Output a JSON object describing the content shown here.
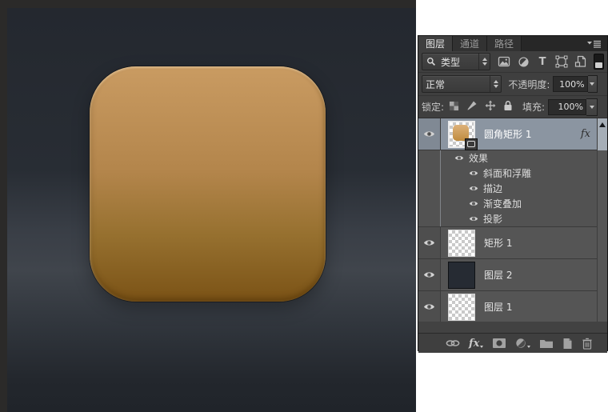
{
  "canvas": {
    "document_bg_top": "#24282f",
    "document_bg_mid": "#40454c",
    "document_bg_bottom": "#20242a",
    "shape": {
      "label": "rounded-rectangle",
      "gradient_top": "#c99b62",
      "gradient_bottom": "#7b5316",
      "radius_px": 58
    }
  },
  "panel": {
    "tabs": [
      {
        "label": "图层",
        "active": true
      },
      {
        "label": "通道",
        "active": false
      },
      {
        "label": "路径",
        "active": false
      }
    ],
    "filter_row": {
      "search_label": "类型",
      "type_letter": "T"
    },
    "blend_row": {
      "blend_mode": "正常",
      "opacity_label": "不透明度:",
      "opacity_value": "100%"
    },
    "lock_row": {
      "lock_label": "锁定:",
      "fill_label": "填充:",
      "fill_value": "100%"
    },
    "layers": [
      {
        "name": "圆角矩形 1",
        "selected": true,
        "fx_badge": "fx",
        "thumb": "shape-orange-on-checker",
        "effects_header": "效果",
        "effects": [
          "斜面和浮雕",
          "描边",
          "渐变叠加",
          "投影"
        ]
      },
      {
        "name": "矩形 1",
        "selected": false,
        "thumb": "transparent-checker"
      },
      {
        "name": "图层 2",
        "selected": false,
        "thumb": "solid",
        "thumb_color": "#262b33"
      },
      {
        "name": "图层 1",
        "selected": false,
        "thumb": "transparent-checker"
      }
    ],
    "bottom_bar": {
      "fx_label": "fx"
    }
  },
  "colors": {
    "selected_row": "#8b95a1",
    "panel_bg": "#424242",
    "row_bg": "#555555",
    "pasteboard": "#2b2a29"
  }
}
